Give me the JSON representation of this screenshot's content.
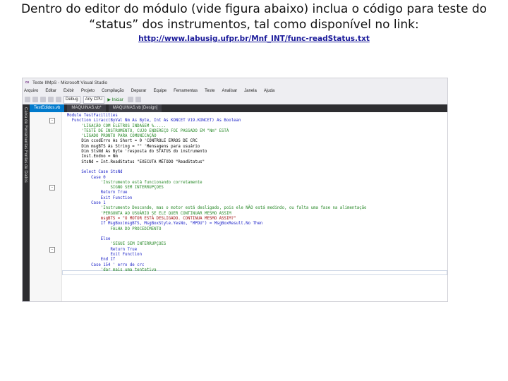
{
  "slide": {
    "heading_line1": "Dentro do editor do módulo (vide figura abaixo) inclua o código para teste do",
    "heading_line2": "“status” dos instrumentos, tal como disponível no link:",
    "link": "http://www.labusig.ufpr.br/Mnf_INT/func-readStatus.txt"
  },
  "vs": {
    "window_title": "Teste IIMpS - Microsoft Visual Studio",
    "menu": [
      "Arquivo",
      "Editar",
      "Exibir",
      "Projeto",
      "Compilação",
      "Depurar",
      "Equipe",
      "Ferramentas",
      "Teste",
      "Analisar",
      "Janela",
      "Ajuda"
    ],
    "toolbar": {
      "config": "Debug",
      "platform": "Any CPU",
      "start": "▶ Iniciar"
    },
    "sidebar_text": "Caixa de Ferramentas    Fontes de Dados",
    "tabs": [
      "TestEdidos.vb",
      "MAQUINAS.vb*",
      "MAQUINAS.vb [Design]"
    ],
    "code": [
      {
        "t": "  Module TestFacilities",
        "c": "kw"
      },
      {
        "t": "    Function Liracc(ByVal Nm As Byte, Int As KONCET V19.KONCET) As Boolean",
        "c": "kw"
      },
      {
        "t": "        'LIGAÇÃO COM ELETROS INDAGEM %.....",
        "c": "cm"
      },
      {
        "t": "        'TESTE DE INSTRUMENTO, CUJO ENDEREÇO FOI PASSADO EM \"Nm\" ESTÁ",
        "c": "cm"
      },
      {
        "t": "        'LIGADO PRONTO PARA COMUNICAÇÃO",
        "c": "cm"
      },
      {
        "t": "        Dim ccodErro As Short = 0 'CONTROLE ERROS DE CRC",
        "c": ""
      },
      {
        "t": "        Dim msgBTS As String = \"\" 'Mensagens para usuário",
        "c": ""
      },
      {
        "t": "        Dim StsNd As Byte 'resposta do STATUS do instrumento",
        "c": ""
      },
      {
        "t": "        Inst.Endno = Nm",
        "c": ""
      },
      {
        "t": "        StsNd = Int.ReadStatus \"EXECUTA MÉTODO \"ReadStatus\"",
        "c": ""
      },
      {
        "t": "",
        "c": ""
      },
      {
        "t": "        Select Case StsNd",
        "c": "kw"
      },
      {
        "t": "            Case 0",
        "c": "kw"
      },
      {
        "t": "                'Instrumento está funcionando corretamente",
        "c": "cm"
      },
      {
        "t": "                    SIGNO SEM INTERRUPÇOES",
        "c": "cm"
      },
      {
        "t": "                Return True",
        "c": "kw"
      },
      {
        "t": "                Exit Function",
        "c": "kw"
      },
      {
        "t": "            Case 1",
        "c": "kw"
      },
      {
        "t": "                'Instrumento Desconde, mas o motor está desligado, pois ele NÃO está medindo, ou falta uma fase na alimentação",
        "c": "cm"
      },
      {
        "t": "                'PERGUNTA AO USUÁRIO SE ELE QUER CONTINUAR MESMO ASSIM",
        "c": "cm"
      },
      {
        "t": "                msgBTS = \"O MOTOR ESTÁ DESLIGADO. CONTINUA MESMO ASSIM?\"",
        "c": "str"
      },
      {
        "t": "                If MsgBox(msgBTS, MsgBoxStyle.YesNo, \"MPDU\") = MsgBoxResult.No Then",
        "c": "kw"
      },
      {
        "t": "                    FALHA DO PROCEDIMENTO",
        "c": "cm"
      },
      {
        "t": "",
        "c": ""
      },
      {
        "t": "                Else",
        "c": "kw"
      },
      {
        "t": "                    'SEGUE SEM INTERRUPÇOES",
        "c": "cm"
      },
      {
        "t": "                    Return True",
        "c": "kw"
      },
      {
        "t": "                    Exit Function",
        "c": "kw"
      },
      {
        "t": "                End If",
        "c": "kw"
      },
      {
        "t": "            Case 154 ' erro de crc",
        "c": "kw"
      },
      {
        "t": "                'dar mais uma tentativa",
        "c": "cm"
      }
    ]
  }
}
